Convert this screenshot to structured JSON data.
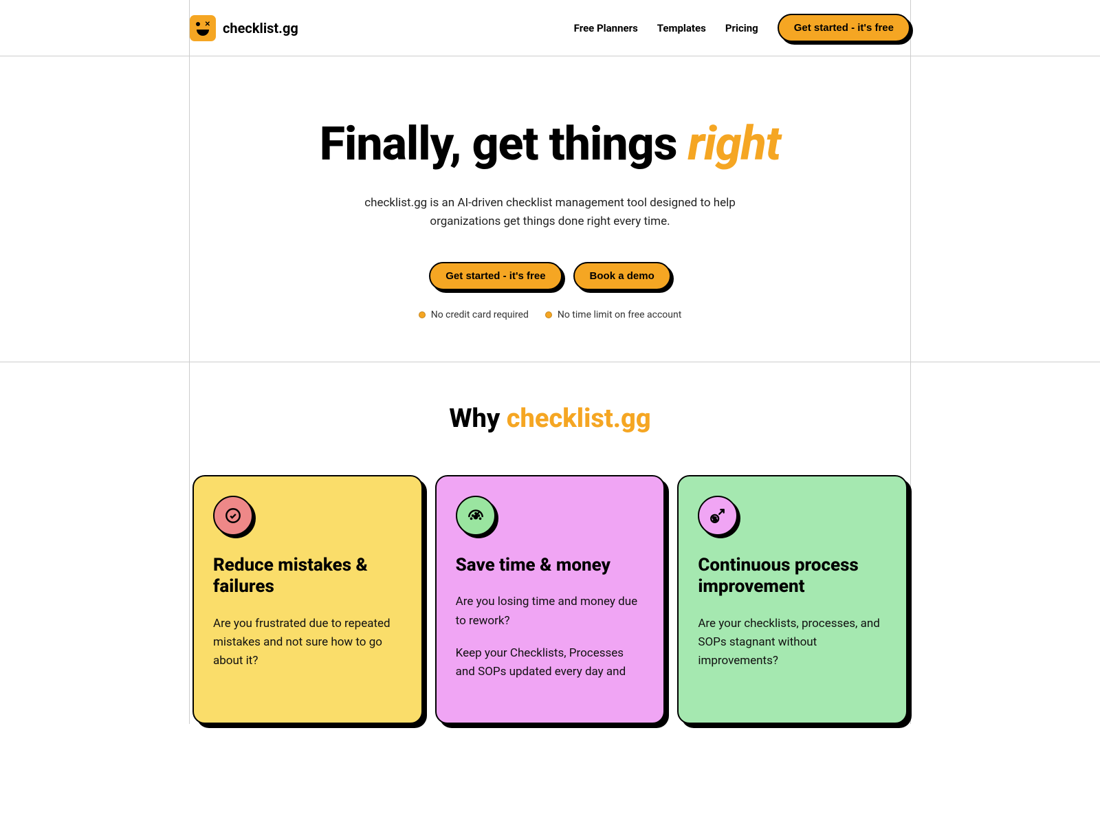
{
  "header": {
    "logo_text": "checklist.gg",
    "nav": {
      "free_planners": "Free Planners",
      "templates": "Templates",
      "pricing": "Pricing"
    },
    "cta": "Get started - it's free"
  },
  "hero": {
    "title_prefix": "Finally, get things ",
    "title_highlight": "right",
    "subtitle": "checklist.gg is an AI-driven checklist management tool designed to help organizations get things done right every time.",
    "btn_primary": "Get started - it's free",
    "btn_secondary": "Book a demo",
    "bullet1": "No credit card required",
    "bullet2": "No time limit on free account"
  },
  "why": {
    "title_prefix": "Why ",
    "title_highlight": "checklist.gg",
    "cards": [
      {
        "title": "Reduce mistakes & failures",
        "p1": "Are you frustrated due to repeated mistakes and not sure how to go about it?"
      },
      {
        "title": "Save time & money",
        "p1": "Are you losing time and money due to rework?",
        "p2": "Keep your Checklists, Processes and SOPs updated every day and"
      },
      {
        "title": "Continuous process improvement",
        "p1": "Are your checklists, processes, and SOPs stagnant without improvements?"
      }
    ]
  }
}
